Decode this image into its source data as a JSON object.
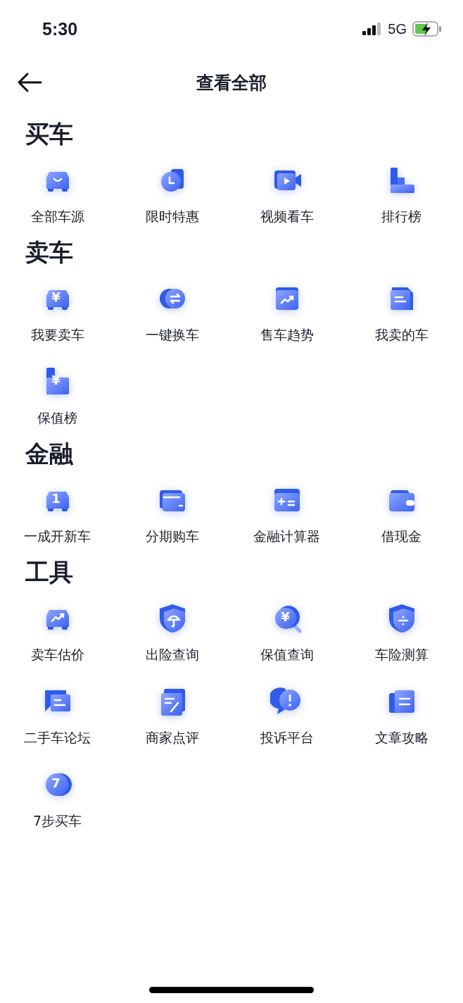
{
  "status_bar": {
    "time": "5:30",
    "network": "5G"
  },
  "nav": {
    "title": "查看全部"
  },
  "sections": [
    {
      "title": "买车",
      "items": [
        {
          "label": "全部车源"
        },
        {
          "label": "限时特惠"
        },
        {
          "label": "视频看车"
        },
        {
          "label": "排行榜"
        }
      ]
    },
    {
      "title": "卖车",
      "items": [
        {
          "label": "我要卖车",
          "glyph": "¥"
        },
        {
          "label": "一键换车"
        },
        {
          "label": "售车趋势"
        },
        {
          "label": "我卖的车"
        },
        {
          "label": "保值榜",
          "glyph": "¥"
        }
      ]
    },
    {
      "title": "金融",
      "items": [
        {
          "label": "一成开新车",
          "glyph": "1"
        },
        {
          "label": "分期购车"
        },
        {
          "label": "金融计算器"
        },
        {
          "label": "借现金"
        }
      ]
    },
    {
      "title": "工具",
      "items": [
        {
          "label": "卖车估价"
        },
        {
          "label": "出险查询"
        },
        {
          "label": "保值查询",
          "glyph": "¥"
        },
        {
          "label": "车险测算"
        },
        {
          "label": "二手车论坛"
        },
        {
          "label": "商家点评"
        },
        {
          "label": "投诉平台"
        },
        {
          "label": "文章攻略"
        },
        {
          "label": "7步买车",
          "glyph": "7"
        }
      ]
    }
  ]
}
